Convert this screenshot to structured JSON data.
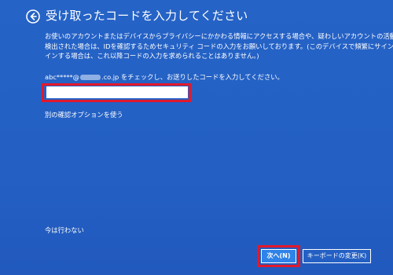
{
  "header": {
    "title": "受け取ったコードを入力してください",
    "back_icon": "arrow-left-circle-icon"
  },
  "description": {
    "lines": [
      "お使いのアカウントまたはデバイスからプライバシーにかかわる情報にアクセスする場合や、疑わしいアカウントの活動が",
      "検出された場合は、IDを確認するためセキュリティ コードの入力をお願いしております。(このデバイスで頻繁にサイン",
      "インする場合は、これ以降コードの入力を求められることはありません。)"
    ]
  },
  "instruction": {
    "prefix": "abc*****@",
    "masked": "",
    "suffix": ".co.jp をチェックし、お送りしたコードを入力してください。"
  },
  "code_input": {
    "value": "",
    "placeholder": ""
  },
  "links": {
    "alt_option": "別の確認オプションを使う",
    "skip": "今は行わない"
  },
  "buttons": {
    "next": "次へ(N)",
    "change_keyboard": "キーボードの変更(K)"
  },
  "colors": {
    "background": "#2460c4",
    "highlight": "#e2192b",
    "primary_button": "#2f83e8"
  }
}
